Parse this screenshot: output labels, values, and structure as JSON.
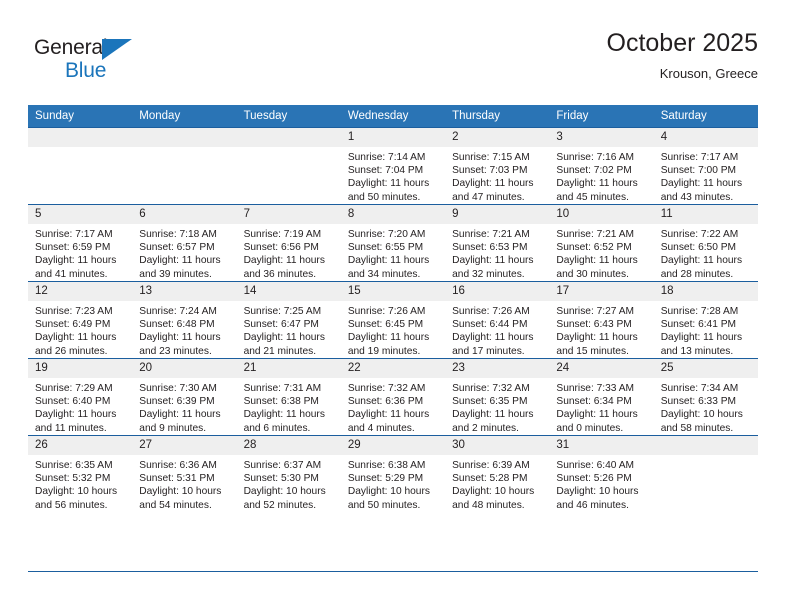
{
  "brand": {
    "name_top": "General",
    "name_bottom": "Blue",
    "accent_color": "#1b75bb"
  },
  "header": {
    "title": "October 2025",
    "subtitle": "Krouson, Greece"
  },
  "calendar": {
    "header_bg": "#2a74b5",
    "daynum_bg": "#efefef",
    "grid_line": "#1b5e9e",
    "weekdays": [
      "Sunday",
      "Monday",
      "Tuesday",
      "Wednesday",
      "Thursday",
      "Friday",
      "Saturday"
    ],
    "labels": {
      "sunrise": "Sunrise:",
      "sunset": "Sunset:",
      "daylight": "Daylight:"
    },
    "weeks": [
      [
        {
          "day": "",
          "empty": true
        },
        {
          "day": "",
          "empty": true
        },
        {
          "day": "",
          "empty": true
        },
        {
          "day": "1",
          "sunrise": "Sunrise: 7:14 AM",
          "sunset": "Sunset: 7:04 PM",
          "daylight": "Daylight: 11 hours and 50 minutes."
        },
        {
          "day": "2",
          "sunrise": "Sunrise: 7:15 AM",
          "sunset": "Sunset: 7:03 PM",
          "daylight": "Daylight: 11 hours and 47 minutes."
        },
        {
          "day": "3",
          "sunrise": "Sunrise: 7:16 AM",
          "sunset": "Sunset: 7:02 PM",
          "daylight": "Daylight: 11 hours and 45 minutes."
        },
        {
          "day": "4",
          "sunrise": "Sunrise: 7:17 AM",
          "sunset": "Sunset: 7:00 PM",
          "daylight": "Daylight: 11 hours and 43 minutes."
        }
      ],
      [
        {
          "day": "5",
          "sunrise": "Sunrise: 7:17 AM",
          "sunset": "Sunset: 6:59 PM",
          "daylight": "Daylight: 11 hours and 41 minutes."
        },
        {
          "day": "6",
          "sunrise": "Sunrise: 7:18 AM",
          "sunset": "Sunset: 6:57 PM",
          "daylight": "Daylight: 11 hours and 39 minutes."
        },
        {
          "day": "7",
          "sunrise": "Sunrise: 7:19 AM",
          "sunset": "Sunset: 6:56 PM",
          "daylight": "Daylight: 11 hours and 36 minutes."
        },
        {
          "day": "8",
          "sunrise": "Sunrise: 7:20 AM",
          "sunset": "Sunset: 6:55 PM",
          "daylight": "Daylight: 11 hours and 34 minutes."
        },
        {
          "day": "9",
          "sunrise": "Sunrise: 7:21 AM",
          "sunset": "Sunset: 6:53 PM",
          "daylight": "Daylight: 11 hours and 32 minutes."
        },
        {
          "day": "10",
          "sunrise": "Sunrise: 7:21 AM",
          "sunset": "Sunset: 6:52 PM",
          "daylight": "Daylight: 11 hours and 30 minutes."
        },
        {
          "day": "11",
          "sunrise": "Sunrise: 7:22 AM",
          "sunset": "Sunset: 6:50 PM",
          "daylight": "Daylight: 11 hours and 28 minutes."
        }
      ],
      [
        {
          "day": "12",
          "sunrise": "Sunrise: 7:23 AM",
          "sunset": "Sunset: 6:49 PM",
          "daylight": "Daylight: 11 hours and 26 minutes."
        },
        {
          "day": "13",
          "sunrise": "Sunrise: 7:24 AM",
          "sunset": "Sunset: 6:48 PM",
          "daylight": "Daylight: 11 hours and 23 minutes."
        },
        {
          "day": "14",
          "sunrise": "Sunrise: 7:25 AM",
          "sunset": "Sunset: 6:47 PM",
          "daylight": "Daylight: 11 hours and 21 minutes."
        },
        {
          "day": "15",
          "sunrise": "Sunrise: 7:26 AM",
          "sunset": "Sunset: 6:45 PM",
          "daylight": "Daylight: 11 hours and 19 minutes."
        },
        {
          "day": "16",
          "sunrise": "Sunrise: 7:26 AM",
          "sunset": "Sunset: 6:44 PM",
          "daylight": "Daylight: 11 hours and 17 minutes."
        },
        {
          "day": "17",
          "sunrise": "Sunrise: 7:27 AM",
          "sunset": "Sunset: 6:43 PM",
          "daylight": "Daylight: 11 hours and 15 minutes."
        },
        {
          "day": "18",
          "sunrise": "Sunrise: 7:28 AM",
          "sunset": "Sunset: 6:41 PM",
          "daylight": "Daylight: 11 hours and 13 minutes."
        }
      ],
      [
        {
          "day": "19",
          "sunrise": "Sunrise: 7:29 AM",
          "sunset": "Sunset: 6:40 PM",
          "daylight": "Daylight: 11 hours and 11 minutes."
        },
        {
          "day": "20",
          "sunrise": "Sunrise: 7:30 AM",
          "sunset": "Sunset: 6:39 PM",
          "daylight": "Daylight: 11 hours and 9 minutes."
        },
        {
          "day": "21",
          "sunrise": "Sunrise: 7:31 AM",
          "sunset": "Sunset: 6:38 PM",
          "daylight": "Daylight: 11 hours and 6 minutes."
        },
        {
          "day": "22",
          "sunrise": "Sunrise: 7:32 AM",
          "sunset": "Sunset: 6:36 PM",
          "daylight": "Daylight: 11 hours and 4 minutes."
        },
        {
          "day": "23",
          "sunrise": "Sunrise: 7:32 AM",
          "sunset": "Sunset: 6:35 PM",
          "daylight": "Daylight: 11 hours and 2 minutes."
        },
        {
          "day": "24",
          "sunrise": "Sunrise: 7:33 AM",
          "sunset": "Sunset: 6:34 PM",
          "daylight": "Daylight: 11 hours and 0 minutes."
        },
        {
          "day": "25",
          "sunrise": "Sunrise: 7:34 AM",
          "sunset": "Sunset: 6:33 PM",
          "daylight": "Daylight: 10 hours and 58 minutes."
        }
      ],
      [
        {
          "day": "26",
          "sunrise": "Sunrise: 6:35 AM",
          "sunset": "Sunset: 5:32 PM",
          "daylight": "Daylight: 10 hours and 56 minutes."
        },
        {
          "day": "27",
          "sunrise": "Sunrise: 6:36 AM",
          "sunset": "Sunset: 5:31 PM",
          "daylight": "Daylight: 10 hours and 54 minutes."
        },
        {
          "day": "28",
          "sunrise": "Sunrise: 6:37 AM",
          "sunset": "Sunset: 5:30 PM",
          "daylight": "Daylight: 10 hours and 52 minutes."
        },
        {
          "day": "29",
          "sunrise": "Sunrise: 6:38 AM",
          "sunset": "Sunset: 5:29 PM",
          "daylight": "Daylight: 10 hours and 50 minutes."
        },
        {
          "day": "30",
          "sunrise": "Sunrise: 6:39 AM",
          "sunset": "Sunset: 5:28 PM",
          "daylight": "Daylight: 10 hours and 48 minutes."
        },
        {
          "day": "31",
          "sunrise": "Sunrise: 6:40 AM",
          "sunset": "Sunset: 5:26 PM",
          "daylight": "Daylight: 10 hours and 46 minutes."
        },
        {
          "day": "",
          "empty": true
        }
      ]
    ]
  }
}
